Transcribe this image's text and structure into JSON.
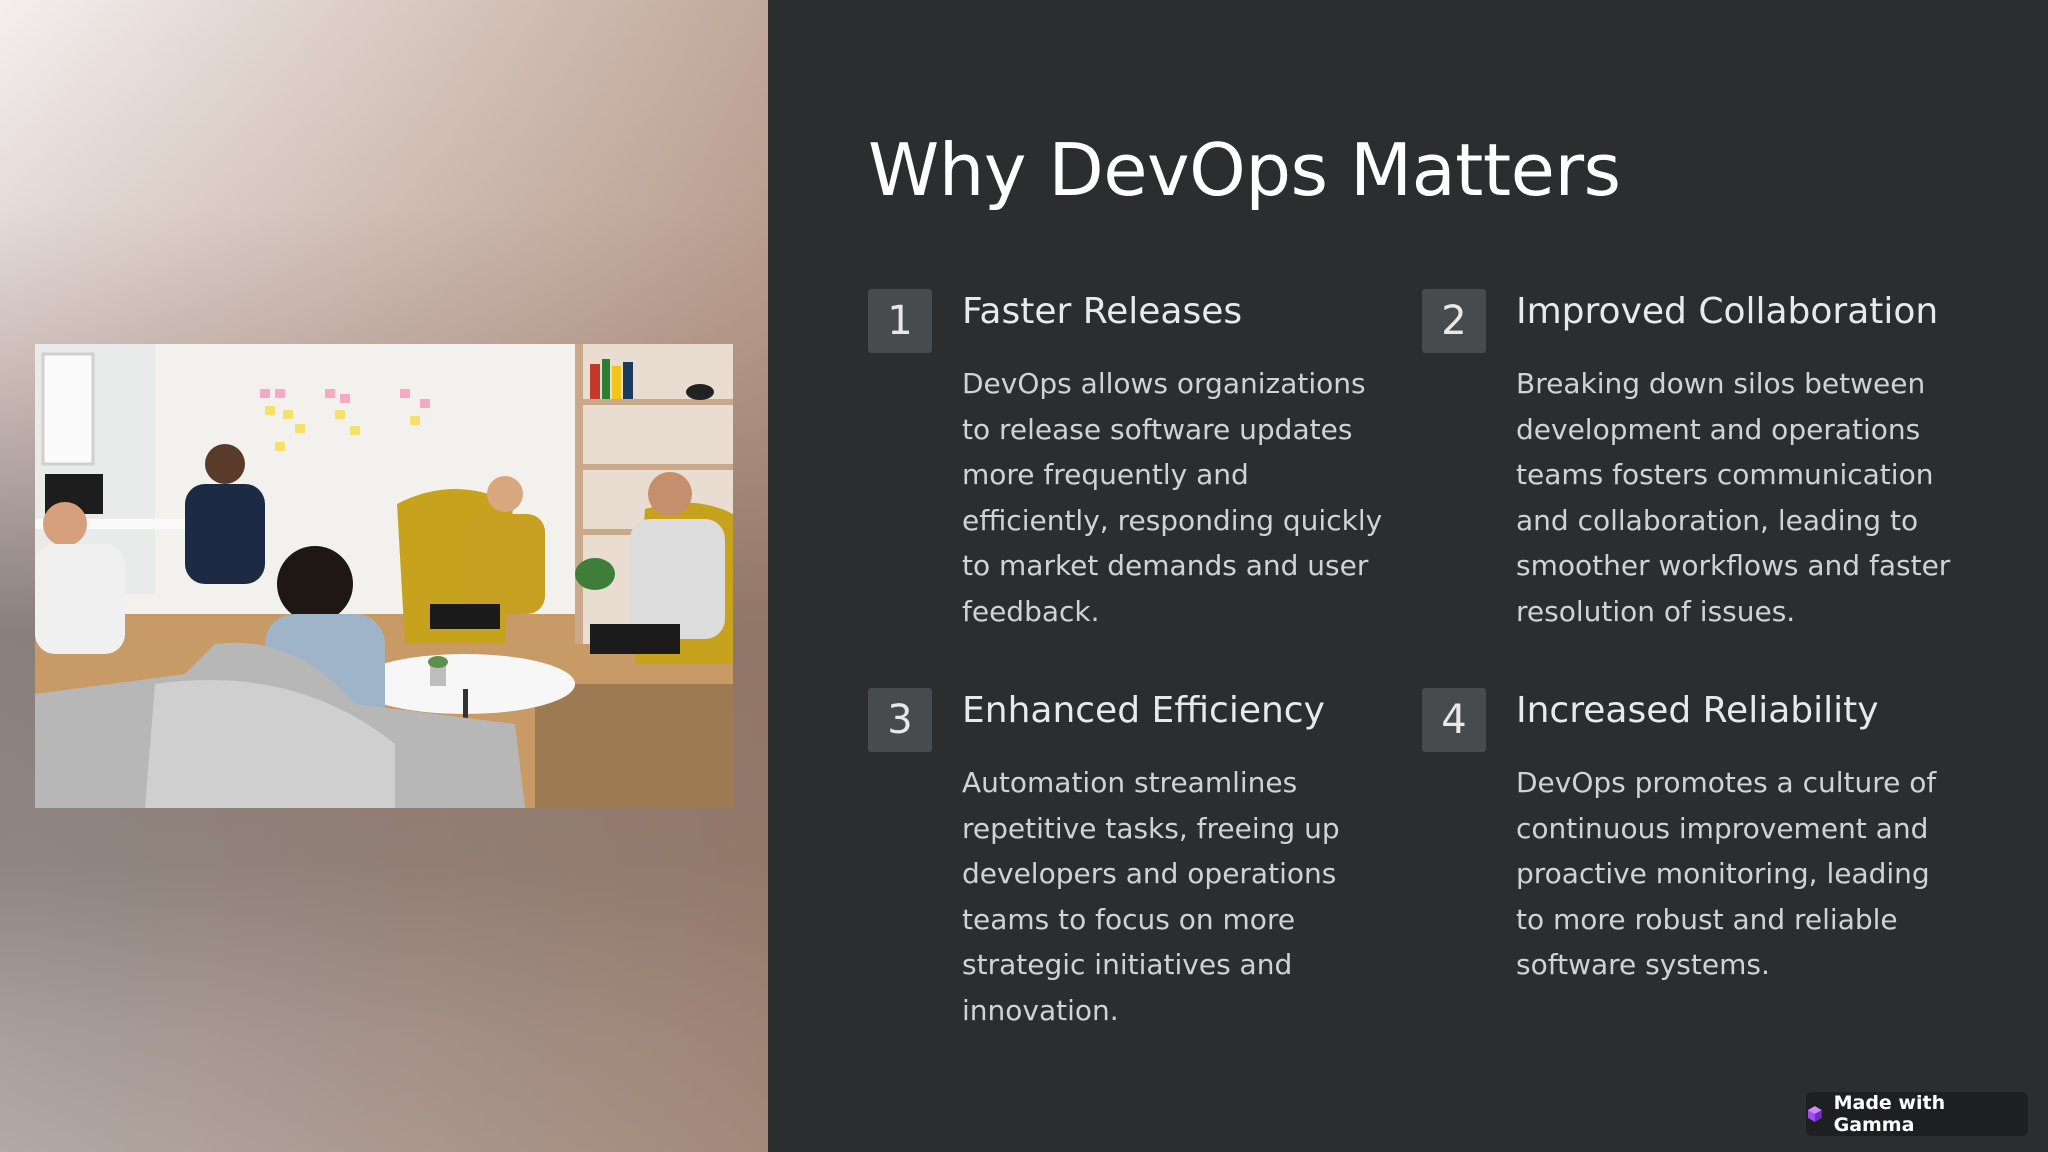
{
  "slide": {
    "title": "Why DevOps Matters",
    "items": [
      {
        "number": "1",
        "title": "Faster Releases",
        "body": "DevOps allows organizations to release software updates more frequently and efficiently, responding quickly to market demands and user feedback."
      },
      {
        "number": "2",
        "title": "Improved Collaboration",
        "body": "Breaking down silos between development and operations teams fosters communication and collaboration, leading to smoother workflows and faster resolution of issues."
      },
      {
        "number": "3",
        "title": "Enhanced Efficiency",
        "body": "Automation streamlines repetitive tasks, freeing up developers and operations teams to focus on more strategic initiatives and innovation."
      },
      {
        "number": "4",
        "title": "Increased Reliability",
        "body": "DevOps promotes a culture of continuous improvement and proactive monitoring, leading to more robust and reliable software systems."
      }
    ]
  },
  "badge": {
    "label": "Made with Gamma",
    "icon": "gamma-logo-icon"
  },
  "colors": {
    "background": "#2b2d2f",
    "number_box": "#484b4e",
    "title_text": "#ffffff",
    "body_text": "#d2d2d2",
    "badge_icon": "#a24bf2"
  }
}
